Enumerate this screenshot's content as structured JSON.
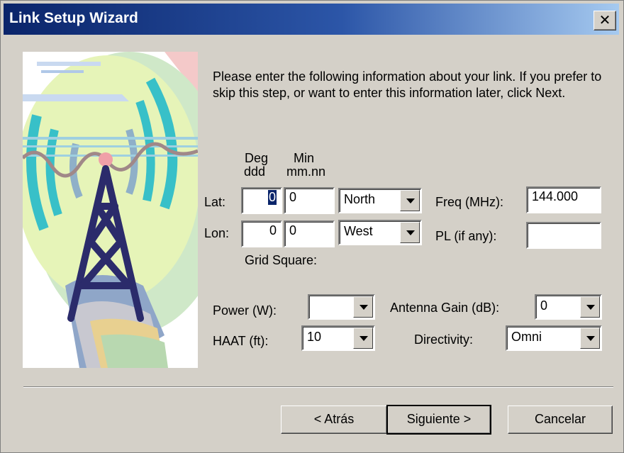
{
  "window": {
    "title": "Link Setup Wizard",
    "close_glyph": "✕"
  },
  "intro_text": "Please enter the following information about your link.  If you prefer to skip this step, or want to enter this information later, click Next.",
  "coords": {
    "deg_header": "Deg",
    "deg_sub": "ddd",
    "min_header": "Min",
    "min_sub": "mm.nn",
    "lat_label": "Lat:",
    "lon_label": "Lon:",
    "lat_deg": "0",
    "lat_min": "0",
    "lat_dir": "North",
    "lon_deg": "0",
    "lon_min": "0",
    "lon_dir": "West",
    "grid_label": "Grid Square:"
  },
  "freq": {
    "label": "Freq (MHz):",
    "value": "144.000"
  },
  "pl": {
    "label": "PL (if any):",
    "value": ""
  },
  "power": {
    "label": "Power (W):",
    "value": ""
  },
  "haat": {
    "label": "HAAT (ft):",
    "value": "10"
  },
  "gain": {
    "label": "Antenna Gain (dB):",
    "value": "0"
  },
  "directivity": {
    "label": "Directivity:",
    "value": "Omni"
  },
  "buttons": {
    "back": "< Atrás",
    "next": "Siguiente >",
    "cancel": "Cancelar"
  },
  "icons": {
    "illustration": "radio-tower-illustration",
    "dropdown": "dropdown-arrow-icon"
  },
  "colors": {
    "titlebar": "#0a246a",
    "face": "#d4d0c8",
    "tower": "#2b2b6b"
  }
}
